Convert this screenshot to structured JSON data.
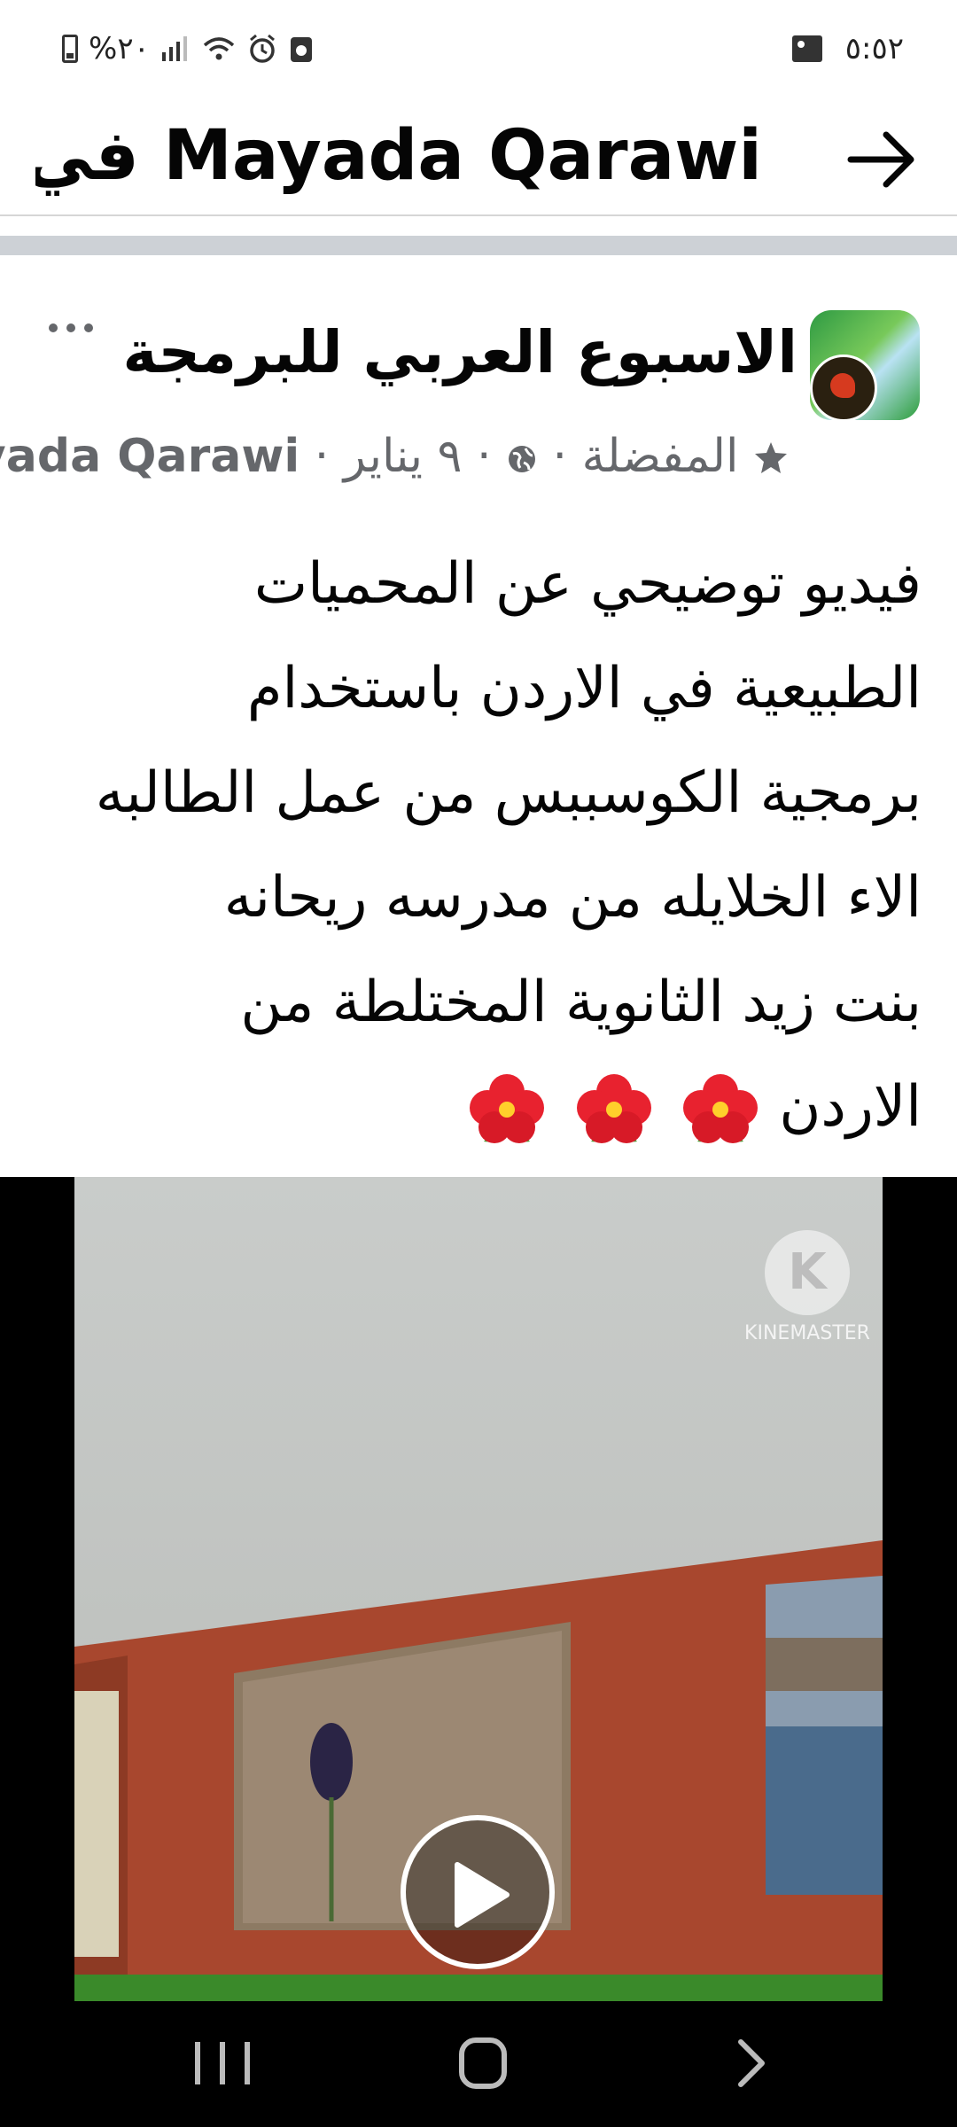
{
  "status_bar": {
    "time": "٥:٥٢",
    "battery": "%٢٠"
  },
  "header": {
    "title": "Mayada Qarawi في ..."
  },
  "post": {
    "group_name": "الاسبوع العربي للبرمجة",
    "meta": {
      "favorites": "المفضلة",
      "date": "٩ يناير",
      "author": "Mayada Qarawi"
    },
    "text_lines": [
      "فيديو توضيحي عن المحميات",
      "الطبيعية في الاردن باستخدام",
      "برمجية الكوسببس من عمل الطالبه",
      "الاء الخلايله من مدرسه ريحانه",
      "بنت زيد الثانوية المختلطة من",
      "الاردن"
    ]
  },
  "video": {
    "watermark": "KINEMASTER"
  },
  "colors": {
    "text": "#050505",
    "secondary": "#65676b",
    "band": "#cdd1d6",
    "wall": "#a8472e"
  },
  "icons": {
    "back": "arrow-right-icon",
    "more": "more-dots-icon",
    "globe": "globe-icon",
    "star": "star-icon",
    "play": "play-icon",
    "flower": "hibiscus-emoji"
  }
}
